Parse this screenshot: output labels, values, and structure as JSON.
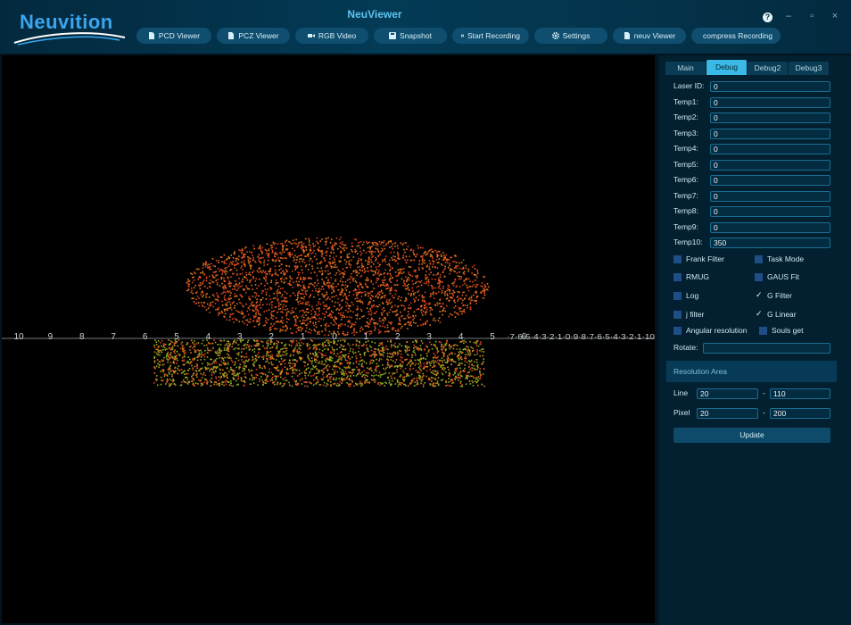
{
  "app": {
    "title": "NeuViewer",
    "logo_text": "Neuvition"
  },
  "window_controls": {
    "help": "?",
    "minimize": "–",
    "maximize": "▫",
    "close": "×"
  },
  "toolbar": [
    {
      "label": "PCD Viewer",
      "icon": "file-icon"
    },
    {
      "label": "PCZ Viewer",
      "icon": "file-icon"
    },
    {
      "label": "RGB Video",
      "icon": "video-camera-icon"
    },
    {
      "label": "Snapshot",
      "icon": "save-icon"
    },
    {
      "label": "Start Recording",
      "icon": "record-icon"
    },
    {
      "label": "Settings",
      "icon": "gear-icon"
    },
    {
      "label": "neuv Viewer",
      "icon": "file-icon"
    },
    {
      "label": "compress Recording",
      "icon": "record-icon"
    }
  ],
  "viewer": {
    "axis_labels": [
      "10",
      "9",
      "8",
      "7",
      "6",
      "5",
      "4",
      "3",
      "2",
      "1",
      "0",
      "1",
      "2",
      "3",
      "4",
      "5",
      "6"
    ],
    "axis_tail_text": "·7·6·5·4·3·2·1·0·9·8·7·6·5·4·3·2·1·10"
  },
  "tabs": [
    {
      "label": "Main",
      "active": false
    },
    {
      "label": "Debug",
      "active": true
    },
    {
      "label": "Debug2",
      "active": false
    },
    {
      "label": "Debug3",
      "active": false
    }
  ],
  "fields": [
    {
      "label": "Laser ID:",
      "value": "0"
    },
    {
      "label": "Temp1:",
      "value": "0"
    },
    {
      "label": "Temp2:",
      "value": "0"
    },
    {
      "label": "Temp3:",
      "value": "0"
    },
    {
      "label": "Temp4:",
      "value": "0"
    },
    {
      "label": "Temp5:",
      "value": "0"
    },
    {
      "label": "Temp6:",
      "value": "0"
    },
    {
      "label": "Temp7:",
      "value": "0"
    },
    {
      "label": "Temp8:",
      "value": "0"
    },
    {
      "label": "Temp9:",
      "value": "0"
    },
    {
      "label": "Temp10:",
      "value": "350"
    }
  ],
  "checkboxes": [
    {
      "label": "Frank Filter",
      "checked": false
    },
    {
      "label": "Task Mode",
      "checked": false
    },
    {
      "label": "RMUG",
      "checked": false
    },
    {
      "label": "GAUS Fit",
      "checked": false
    },
    {
      "label": "Log",
      "checked": false
    },
    {
      "label": "G Filter",
      "checked": true
    },
    {
      "label": "j filter",
      "checked": false
    },
    {
      "label": "G Linear",
      "checked": true
    },
    {
      "label": "Angular resolution",
      "checked": false
    },
    {
      "label": "Souls get",
      "checked": false
    }
  ],
  "rotate": {
    "label": "Rotate:",
    "value": ""
  },
  "resolution": {
    "title": "Resolution Area",
    "line": {
      "label": "Line",
      "from": "20",
      "to": "110",
      "sep": "-"
    },
    "pixel": {
      "label": "Pixel",
      "from": "20",
      "to": "200",
      "sep": "-"
    },
    "update_label": "Update"
  },
  "colors": {
    "accent": "#3bb9e6",
    "panel": "#02202f",
    "header": "#033a55",
    "cloud_red": "#d8421c",
    "cloud_orange": "#e0781e",
    "cloud_green": "#8fb022"
  }
}
